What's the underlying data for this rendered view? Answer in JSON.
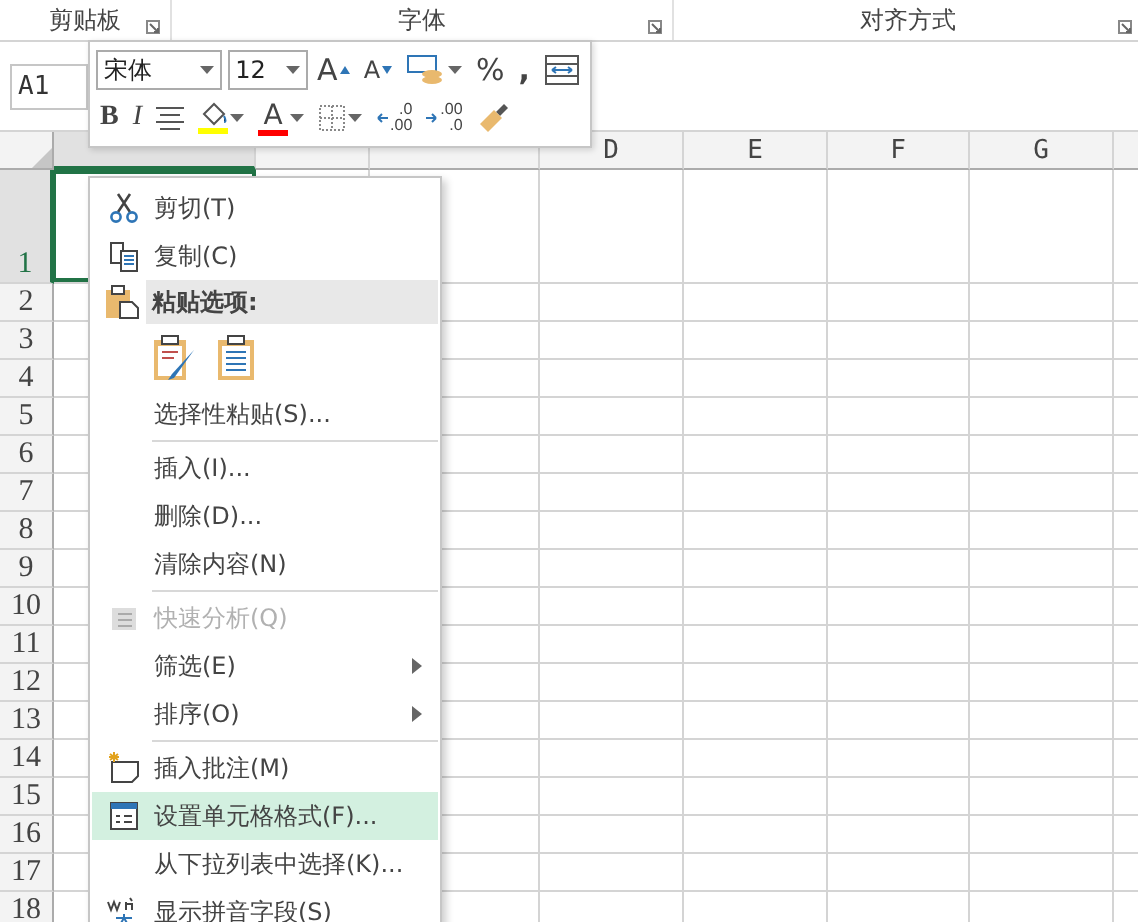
{
  "ribbon_groups": [
    {
      "label": "剪贴板"
    },
    {
      "label": "字体"
    },
    {
      "label": "对齐方式"
    }
  ],
  "name_box": {
    "value": "A1"
  },
  "mini_toolbar": {
    "font": "宋体",
    "size": "12",
    "grow_font": "A",
    "shrink_font": "A",
    "percent": "%",
    "comma": ",",
    "bold": "B",
    "italic": "I",
    "font_color": "A",
    "decimals": [
      {
        "kind": "increase",
        "top": ".0",
        "bottom": ".00"
      },
      {
        "kind": "decrease",
        "top": ".00",
        "bottom": ".0"
      }
    ]
  },
  "columns": [
    {
      "selected": true
    },
    {
      "selected": false
    },
    {
      "selected": false
    },
    {
      "label": "D",
      "selected": false
    },
    {
      "label": "E",
      "selected": false
    },
    {
      "label": "F",
      "selected": false
    },
    {
      "label": "G",
      "selected": false
    }
  ],
  "rows": [
    {
      "label": "1",
      "selected": true
    },
    {
      "label": "2",
      "selected": false
    },
    {
      "label": "3",
      "selected": false
    },
    {
      "label": "4",
      "selected": false
    },
    {
      "label": "5",
      "selected": false
    },
    {
      "label": "6",
      "selected": false
    },
    {
      "label": "7",
      "selected": false
    },
    {
      "label": "8",
      "selected": false
    },
    {
      "label": "9",
      "selected": false
    },
    {
      "label": "10",
      "selected": false
    },
    {
      "label": "11",
      "selected": false
    },
    {
      "label": "12",
      "selected": false
    },
    {
      "label": "13",
      "selected": false
    },
    {
      "label": "14",
      "selected": false
    },
    {
      "label": "15",
      "selected": false
    },
    {
      "label": "16",
      "selected": false
    },
    {
      "label": "17",
      "selected": false
    },
    {
      "label": "18",
      "selected": false
    }
  ],
  "context_menu": [
    {
      "kind": "item",
      "label": "剪切(T)",
      "disabled": false,
      "highlighted": false,
      "submenu": false
    },
    {
      "kind": "item",
      "label": "复制(C)",
      "disabled": false,
      "highlighted": false,
      "submenu": false
    },
    {
      "kind": "header",
      "label": "粘贴选项:"
    },
    {
      "kind": "paste_options"
    },
    {
      "kind": "item",
      "label": "选择性粘贴(S)...",
      "disabled": false,
      "highlighted": false,
      "submenu": false
    },
    {
      "kind": "separator"
    },
    {
      "kind": "item",
      "label": "插入(I)...",
      "disabled": false,
      "highlighted": false,
      "submenu": false
    },
    {
      "kind": "item",
      "label": "删除(D)...",
      "disabled": false,
      "highlighted": false,
      "submenu": false
    },
    {
      "kind": "item",
      "label": "清除内容(N)",
      "disabled": false,
      "highlighted": false,
      "submenu": false
    },
    {
      "kind": "separator"
    },
    {
      "kind": "item",
      "label": "快速分析(Q)",
      "disabled": true,
      "highlighted": false,
      "submenu": false
    },
    {
      "kind": "item",
      "label": "筛选(E)",
      "disabled": false,
      "highlighted": false,
      "submenu": true
    },
    {
      "kind": "item",
      "label": "排序(O)",
      "disabled": false,
      "highlighted": false,
      "submenu": true
    },
    {
      "kind": "separator"
    },
    {
      "kind": "item",
      "label": "插入批注(M)",
      "disabled": false,
      "highlighted": false,
      "submenu": false
    },
    {
      "kind": "item",
      "label": "设置单元格格式(F)...",
      "disabled": false,
      "highlighted": true,
      "submenu": false
    },
    {
      "kind": "item",
      "label": "从下拉列表中选择(K)...",
      "disabled": false,
      "highlighted": false,
      "submenu": false
    },
    {
      "kind": "item",
      "label": "显示拼音字段(S)",
      "disabled": false,
      "highlighted": false,
      "submenu": false
    }
  ]
}
